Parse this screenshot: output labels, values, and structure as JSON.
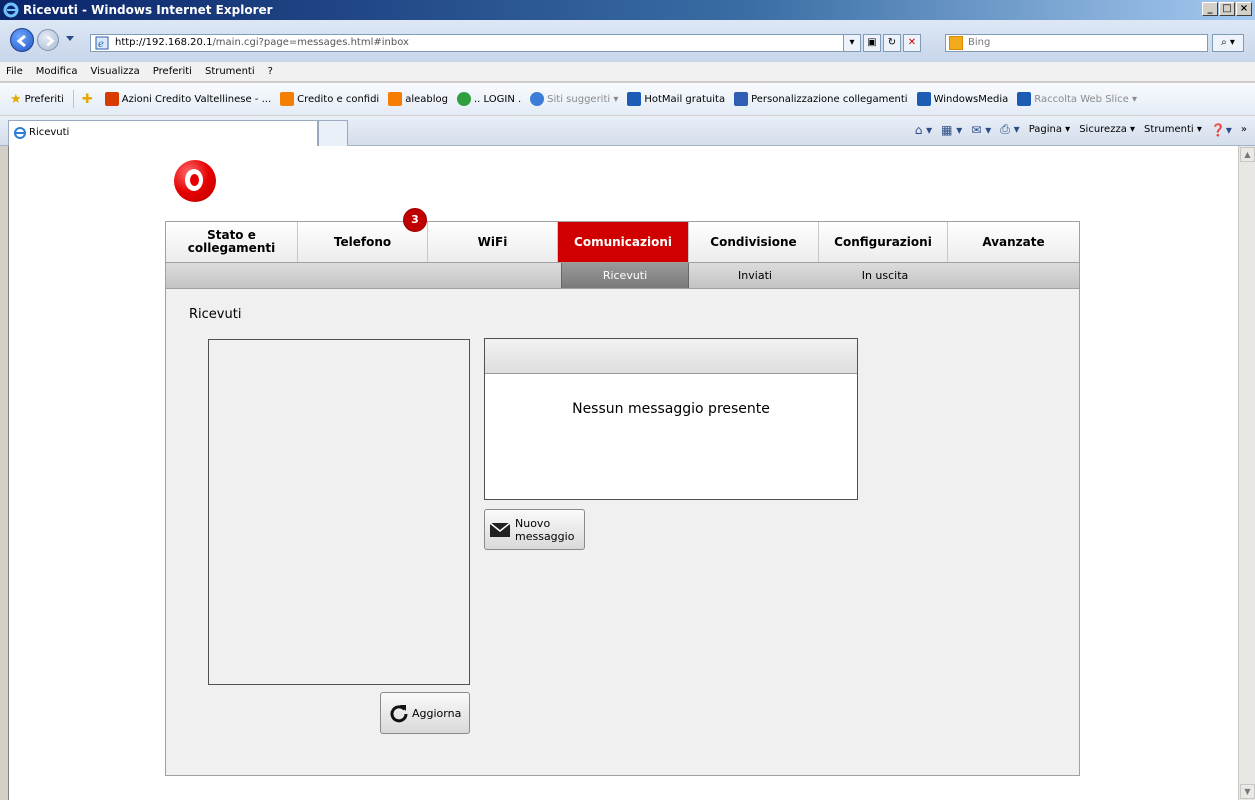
{
  "window": {
    "title": "Ricevuti - Windows Internet Explorer",
    "controls": [
      "_",
      "□",
      "×"
    ]
  },
  "address": {
    "url_host": "http://192.168.20.1",
    "url_path": "/main.cgi?page=messages.html#inbox",
    "search_placeholder": "Bing"
  },
  "menu": [
    "File",
    "Modifica",
    "Visualizza",
    "Preferiti",
    "Strumenti",
    "?"
  ],
  "favorites": {
    "label": "Preferiti",
    "items": [
      {
        "label": "Azioni Credito Valtellinese - ...",
        "color": "#d83b01"
      },
      {
        "label": "Credito e confidi",
        "color": "#f57d00"
      },
      {
        "label": "aleablog",
        "color": "#f57d00"
      },
      {
        "label": ".. LOGIN .",
        "color": "#2e9e3e"
      },
      {
        "label": "Siti suggeriti ▾",
        "color": "#3b7dd8",
        "muted": true
      },
      {
        "label": "HotMail gratuita",
        "color": "#1c5cb4"
      },
      {
        "label": "Personalizzazione collegamenti",
        "color": "#2f5fb3"
      },
      {
        "label": "WindowsMedia",
        "color": "#1c5cb4"
      },
      {
        "label": "Raccolta Web Slice ▾",
        "color": "#1c5cb4",
        "muted": true
      }
    ]
  },
  "tab": {
    "label": "Ricevuti"
  },
  "commands": [
    "Pagina ▾",
    "Sicurezza ▾",
    "Strumenti ▾"
  ],
  "nav": {
    "items": [
      {
        "label": "Stato e\ncollegamenti"
      },
      {
        "label": "Telefono",
        "badge": "3"
      },
      {
        "label": "WiFi"
      },
      {
        "label": "Comunicazioni",
        "active": true
      },
      {
        "label": "Condivisione"
      },
      {
        "label": "Configurazioni"
      },
      {
        "label": "Avanzate"
      }
    ],
    "sub": [
      {
        "label": "Ricevuti",
        "active": true
      },
      {
        "label": "Inviati"
      },
      {
        "label": "In uscita"
      }
    ]
  },
  "content": {
    "title": "Ricevuti",
    "empty_message": "Nessun messaggio presente",
    "new_message_label_1": "Nuovo",
    "new_message_label_2": "messaggio",
    "refresh_label": "Aggiorna"
  },
  "colors": {
    "brand_red": "#e60000",
    "active_tab": "#d00000"
  }
}
